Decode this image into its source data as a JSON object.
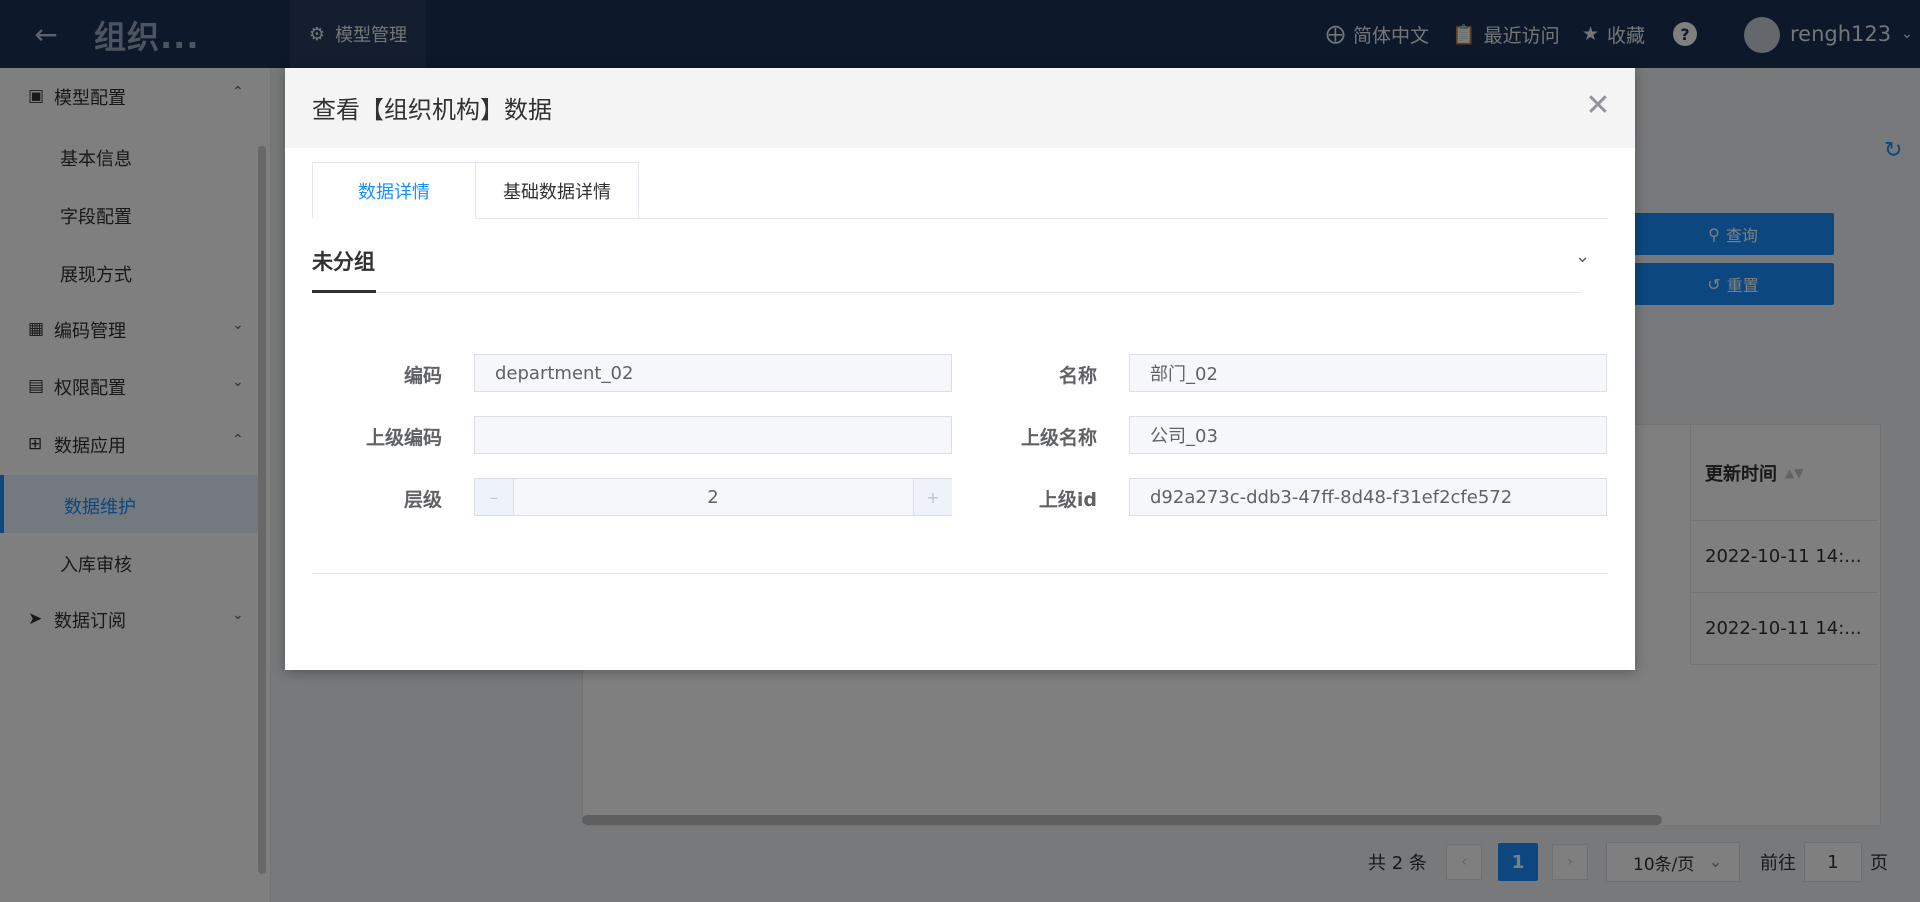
{
  "header": {
    "app_title": "组织...",
    "nav_tab": "模型管理",
    "language": "简体中文",
    "recent": "最近访问",
    "favorites": "收藏",
    "help": "?",
    "username": "rengh123"
  },
  "sidebar": {
    "groups": [
      {
        "label": "模型配置",
        "items": [
          "基本信息",
          "字段配置",
          "展现方式"
        ]
      },
      {
        "label": "编码管理"
      },
      {
        "label": "权限配置"
      },
      {
        "label": "数据应用",
        "items": [
          "数据维护",
          "入库审核"
        ]
      },
      {
        "label": "数据订阅"
      }
    ],
    "active_item": "数据维护"
  },
  "page": {
    "query_button": "查询",
    "reset_button": "重置",
    "table": {
      "column_updated": "更新时间",
      "rows": [
        {
          "updated": "2022-10-11 14:..."
        },
        {
          "updated": "2022-10-11 14:..."
        }
      ]
    },
    "pagination": {
      "total": "共 2 条",
      "current_page": "1",
      "page_size": "10条/页",
      "goto_prefix": "前往",
      "goto_value": "1",
      "goto_suffix": "页"
    }
  },
  "dialog": {
    "title": "查看【组织机构】数据",
    "tabs": [
      "数据详情",
      "基础数据详情"
    ],
    "active_tab": "数据详情",
    "group_title": "未分组",
    "fields": {
      "code_label": "编码",
      "code_value": "department_02",
      "name_label": "名称",
      "name_value": "部门_02",
      "parent_code_label": "上级编码",
      "parent_code_value": "",
      "parent_name_label": "上级名称",
      "parent_name_value": "公司_03",
      "level_label": "层级",
      "level_value": "2",
      "parent_id_label": "上级id",
      "parent_id_value": "d92a273c-ddb3-47ff-8d48-f31ef2cfe572"
    }
  }
}
